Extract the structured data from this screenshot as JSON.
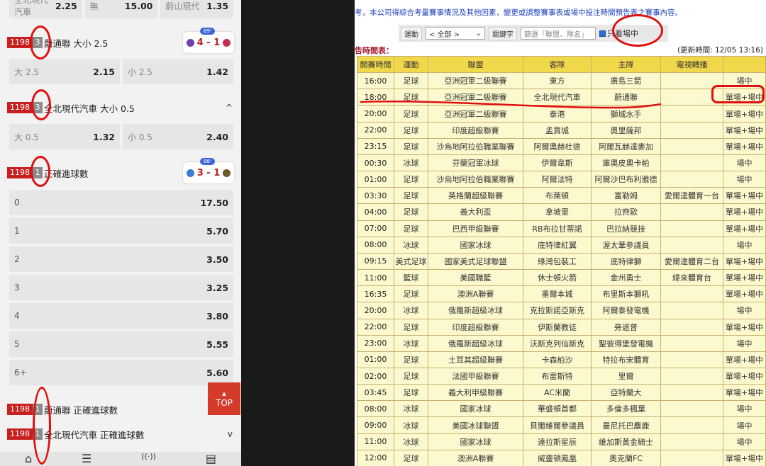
{
  "left_panel": {
    "top_odds": {
      "home_label": "全北現代汽車",
      "home_odd": "2.25",
      "draw_label": "無",
      "draw_odd": "15.00",
      "away_label": "蔚山現代",
      "away_odd": "1.35"
    },
    "markets": [
      {
        "id": "1198",
        "count": "3",
        "title": "蔚通聯 大小 2.5",
        "score": "4 - 1",
        "score_tag": "89'"
      },
      {
        "id": "1198",
        "count": "3",
        "title": "全北現代汽車 大小 0.5",
        "chevron": "^"
      },
      {
        "id": "1198",
        "count": "1",
        "title": "正確進球數",
        "score": "3 - 1",
        "score_tag": "88'"
      },
      {
        "id": "1198",
        "count": "1",
        "title": "蔚通聯 正確進球數"
      },
      {
        "id": "1198",
        "count": "1",
        "title": "全北現代汽車 正確進球數",
        "chevron": "v"
      }
    ],
    "ou25": {
      "over_label": "大 2.5",
      "over_odd": "2.15",
      "under_label": "小 2.5",
      "under_odd": "1.42"
    },
    "ou05": {
      "over_label": "大 0.5",
      "over_odd": "1.32",
      "under_label": "小 0.5",
      "under_odd": "2.40"
    },
    "correct_goals": [
      {
        "label": "0",
        "odd": "17.50"
      },
      {
        "label": "1",
        "odd": "5.70"
      },
      {
        "label": "2",
        "odd": "3.50"
      },
      {
        "label": "3",
        "odd": "3.25"
      },
      {
        "label": "4",
        "odd": "3.80"
      },
      {
        "label": "5",
        "odd": "5.55"
      },
      {
        "label": "6+",
        "odd": "5.60"
      }
    ],
    "top_button": "TOP",
    "nav_icons": [
      "home-icon",
      "menu-icon",
      "live-icon",
      "betslip-icon"
    ]
  },
  "right_panel": {
    "notice": "考，本公司得綜合考量賽事情況及其他因素，變更或調整賽事表或場中投注時間預告表之賽事內容。",
    "filter": {
      "sport_label": "運動",
      "sport_value": "< 全部 >",
      "keyword_label": "關鍵字",
      "keyword_placeholder": "篩選「聯盟、隊名」",
      "only_live_label": "只看場中"
    },
    "subtitle": "告時間表：",
    "update_time": "(更新時間: 12/05 13:16)",
    "columns": [
      "開賽時間",
      "運動",
      "聯盟",
      "客隊",
      "主隊",
      "電視轉播",
      ""
    ],
    "rows": [
      [
        "16:00",
        "足球",
        "亞洲冠軍二級聯賽",
        "東方",
        "廣島三箭",
        "",
        "場中"
      ],
      [
        "18:00",
        "足球",
        "亞洲冠軍二級聯賽",
        "全北現代汽車",
        "蔚通聯",
        "",
        "單場+場中"
      ],
      [
        "20:00",
        "足球",
        "亞洲冠軍二級聯賽",
        "泰港",
        "獅城水手",
        "",
        "單場+場中"
      ],
      [
        "22:00",
        "足球",
        "印度超級聯賽",
        "孟買城",
        "奧里薩邦",
        "",
        "單場+場中"
      ],
      [
        "23:15",
        "足球",
        "沙烏地阿拉伯職業聯賽",
        "阿爾奧赫杜德",
        "阿爾瓦赫達麥加",
        "",
        "單場+場中"
      ],
      [
        "00:30",
        "冰球",
        "芬蘭冠軍冰球",
        "伊爾韋斯",
        "庫奧皮奧卡帕",
        "",
        "場中"
      ],
      [
        "01:00",
        "足球",
        "沙烏地阿拉伯職業聯賽",
        "阿爾法特",
        "阿爾沙巴布利雅德",
        "",
        "場中"
      ],
      [
        "03:30",
        "足球",
        "英格蘭超級聯賽",
        "布萊頓",
        "富勒姆",
        "愛爾達體育一台",
        "單場+場中"
      ],
      [
        "04:00",
        "足球",
        "義大利盃",
        "拿坡里",
        "拉齊歐",
        "",
        "單場+場中"
      ],
      [
        "07:00",
        "足球",
        "巴西甲級聯賽",
        "RB布拉甘蒂諾",
        "巴拉納競技",
        "",
        "單場+場中"
      ],
      [
        "08:00",
        "冰球",
        "國家冰球",
        "底特律紅翼",
        "渥太華參議員",
        "",
        "場中"
      ],
      [
        "09:15",
        "美式足球",
        "國家美式足球聯盟",
        "綠灣包裝工",
        "底特律獅",
        "愛爾達體育二台",
        "單場+場中"
      ],
      [
        "11:00",
        "籃球",
        "美國職籃",
        "休士頓火箭",
        "金州勇士",
        "緯來體育台",
        "單場+場中"
      ],
      [
        "16:35",
        "足球",
        "澳洲A聯賽",
        "墨爾本城",
        "布里斯本獅吼",
        "",
        "單場+場中"
      ],
      [
        "20:00",
        "冰球",
        "俄羅斯超級冰球",
        "克拉斯諾亞斯克",
        "阿爾泰發電機",
        "",
        "場中"
      ],
      [
        "22:00",
        "足球",
        "印度超級聯賽",
        "伊斯蘭教徒",
        "旁遮普",
        "",
        "單場+場中"
      ],
      [
        "23:00",
        "冰球",
        "俄羅斯超級冰球",
        "沃斯克列仙斯克",
        "聖彼得堡發電機",
        "",
        "場中"
      ],
      [
        "01:00",
        "足球",
        "土耳其超級聯賽",
        "卡森柏沙",
        "特拉布宋體育",
        "",
        "單場+場中"
      ],
      [
        "02:00",
        "足球",
        "法國甲級聯賽",
        "布雷斯特",
        "里爾",
        "",
        "單場+場中"
      ],
      [
        "03:45",
        "足球",
        "義大利甲級聯賽",
        "AC米蘭",
        "亞特蘭大",
        "",
        "單場+場中"
      ],
      [
        "08:00",
        "冰球",
        "國家冰球",
        "華盛頓首都",
        "多倫多楓葉",
        "",
        "場中"
      ],
      [
        "09:00",
        "冰球",
        "美國冰球聯盟",
        "貝爾維爾參議員",
        "曼尼托巴麋鹿",
        "",
        "場中"
      ],
      [
        "11:00",
        "冰球",
        "國家冰球",
        "達拉斯星辰",
        "維加斯黃金騎士",
        "",
        "場中"
      ],
      [
        "12:00",
        "足球",
        "澳洲A聯賽",
        "威靈頓鳳凰",
        "奧克蘭FC",
        "",
        "單場+場中"
      ]
    ]
  },
  "colors": {
    "accent_red": "#c82020",
    "header_yellow": "#f1d84b",
    "row_yellow": "#fdf9cf",
    "annotation_red": "#e01010",
    "link_blue": "#1b3fbf"
  }
}
